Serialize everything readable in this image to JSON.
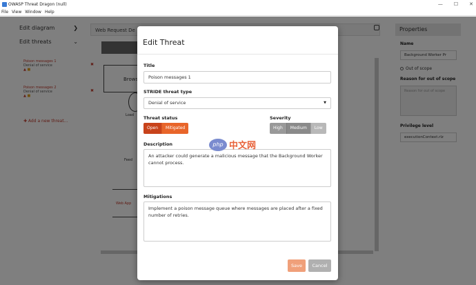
{
  "window": {
    "title": "OWASP Threat Dragon (null)",
    "controls": [
      "—",
      "☐",
      "✕"
    ]
  },
  "menu": [
    "File",
    "View",
    "Window",
    "Help"
  ],
  "leftnav": {
    "edit_diagram": "Edit diagram",
    "edit_threats": "Edit threats",
    "threats": [
      {
        "title": "Poison messages 1",
        "type": "Denial of service"
      },
      {
        "title": "Poison messages 2",
        "type": "Denial of service"
      }
    ],
    "add_new": "✚ Add a new threat…"
  },
  "diagram": {
    "header": "Web Request De",
    "nodes": [
      "Browser",
      "Load",
      "Feed",
      "Web App"
    ]
  },
  "properties": {
    "header": "Properties",
    "name_label": "Name",
    "name_value": "Background Worker Pr",
    "out_of_scope": "Out of scope",
    "reason_label": "Reason for out of scope",
    "reason_placeholder": "Reason for out of scope",
    "privilege_label": "Privilege level",
    "privilege_value": "executionContext.rlz"
  },
  "modal": {
    "title": "Edit Threat",
    "title_label": "Title",
    "title_value": "Poison messages 1",
    "stride_label": "STRIDE threat type",
    "stride_value": "Denial of service",
    "status_label": "Threat status",
    "status_options": [
      "Open",
      "Mitigated"
    ],
    "severity_label": "Severity",
    "severity_options": [
      "High",
      "Medium",
      "Low"
    ],
    "description_label": "Description",
    "description_value": "An attacker could generate a malicious message that the Background Worker cannot process.",
    "mitigations_label": "Mitigations",
    "mitigations_value": "Implement a poison message queue where messages are placed after a fixed number of retries.",
    "save": "Save",
    "cancel": "Cancel"
  },
  "watermark": {
    "logo": "php",
    "text": "中文网"
  },
  "colors": {
    "accent": "#e8652a",
    "open": "#c8431b",
    "overlay": "rgba(0,0,0,0.5)"
  }
}
